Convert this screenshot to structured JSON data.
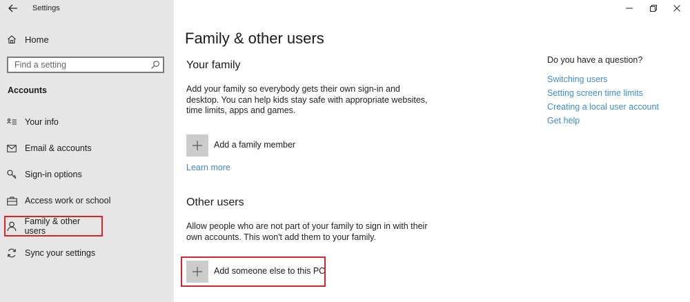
{
  "window": {
    "title": "Settings"
  },
  "sidebar": {
    "home_label": "Home",
    "search_placeholder": "Find a setting",
    "section_heading": "Accounts",
    "items": [
      {
        "label": "Your info",
        "icon": "contact-card-icon",
        "selected": false
      },
      {
        "label": "Email & accounts",
        "icon": "mail-icon",
        "selected": false
      },
      {
        "label": "Sign-in options",
        "icon": "key-icon",
        "selected": false
      },
      {
        "label": "Access work or school",
        "icon": "briefcase-icon",
        "selected": false
      },
      {
        "label": "Family & other users",
        "icon": "person-icon",
        "selected": true
      },
      {
        "label": "Sync your settings",
        "icon": "sync-icon",
        "selected": false
      }
    ]
  },
  "main": {
    "title": "Family & other users",
    "your_family": {
      "heading": "Your family",
      "description": "Add your family so everybody gets their own sign-in and desktop. You can help kids stay safe with appropriate websites, time limits, apps and games.",
      "add_label": "Add a family member",
      "learn_more": "Learn more"
    },
    "other_users": {
      "heading": "Other users",
      "description": "Allow people who are not part of your family to sign in with their own accounts. This won't add them to your family.",
      "add_label": "Add someone else to this PC"
    }
  },
  "help": {
    "question": "Do you have a question?",
    "links": [
      "Switching users",
      "Setting screen time limits",
      "Creating a local user account",
      "Get help"
    ]
  },
  "colors": {
    "sidebar_bg": "#e6e6e6",
    "link": "#3c8dcf",
    "highlight": "#d7232a",
    "plus_tile": "#cccccc"
  }
}
